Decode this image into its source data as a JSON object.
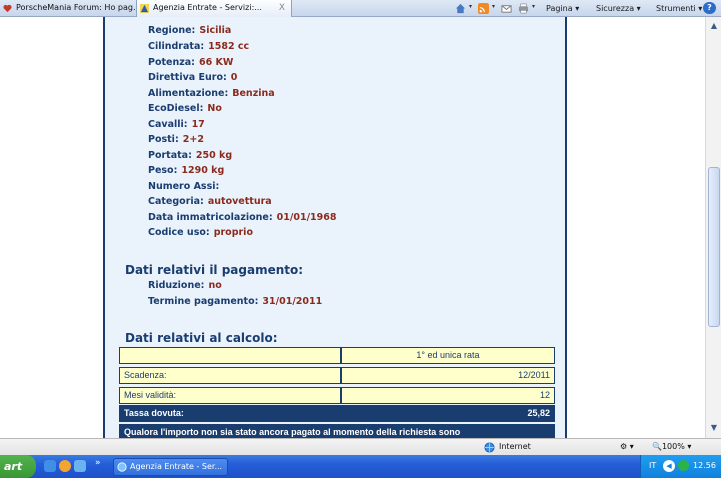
{
  "browser": {
    "tabs": [
      {
        "label": "PorscheMania Forum: Ho pag..."
      },
      {
        "label": "Agenzia Entrate - Servizi:..."
      }
    ],
    "tab_close": "X",
    "commands": {
      "pagina": "Pagina",
      "sicurezza": "Sicurezza",
      "strumenti": "Strumenti",
      "help": "?"
    },
    "dropdown_glyph": "▾"
  },
  "vehicle": {
    "rows": [
      {
        "label": "Regione:",
        "value": "Sicilia"
      },
      {
        "label": "Cilindrata:",
        "value": "1582 cc"
      },
      {
        "label": "Potenza:",
        "value": "66 KW"
      },
      {
        "label": "Direttiva Euro:",
        "value": "0"
      },
      {
        "label": "Alimentazione:",
        "value": "Benzina"
      },
      {
        "label": "EcoDiesel:",
        "value": "No"
      },
      {
        "label": "Cavalli:",
        "value": "17"
      },
      {
        "label": "Posti:",
        "value": "2+2"
      },
      {
        "label": "Portata:",
        "value": "250 kg"
      },
      {
        "label": "Peso:",
        "value": "1290 kg"
      },
      {
        "label": "Numero Assi:",
        "value": ""
      },
      {
        "label": "Categoria:",
        "value": "autovettura"
      },
      {
        "label": "Data immatricolazione:",
        "value": "01/01/1968"
      },
      {
        "label": "Codice uso:",
        "value": "proprio"
      }
    ]
  },
  "payment": {
    "title": "Dati relativi il pagamento:",
    "rows": [
      {
        "label": "Riduzione:",
        "value": "no"
      },
      {
        "label": "Termine pagamento:",
        "value": "31/01/2011"
      }
    ]
  },
  "calc": {
    "title": "Dati relativi al calcolo:",
    "header": {
      "col1": "",
      "col2": "1° ed unica rata"
    },
    "rows": [
      {
        "label": "Scadenza:",
        "value": "12/2011"
      },
      {
        "label": "Mesi validità:",
        "value": "12"
      },
      {
        "label": "Tassa dovuta:",
        "value": "25,82"
      }
    ],
    "note": "Qualora l'importo non sia stato ancora pagato al momento della richiesta sono"
  },
  "statusbar": {
    "zone": "Internet",
    "zoom": "100%"
  },
  "taskbar": {
    "start": "art",
    "window": "Agenzia Entrate - Ser...",
    "lang": "IT",
    "time": "12.56",
    "more": "»"
  },
  "colors": {
    "navy": "#1a3d70",
    "value_red": "#8b2a1c",
    "panel_bg": "#eaf3fc",
    "table_light": "#ffffcc"
  }
}
